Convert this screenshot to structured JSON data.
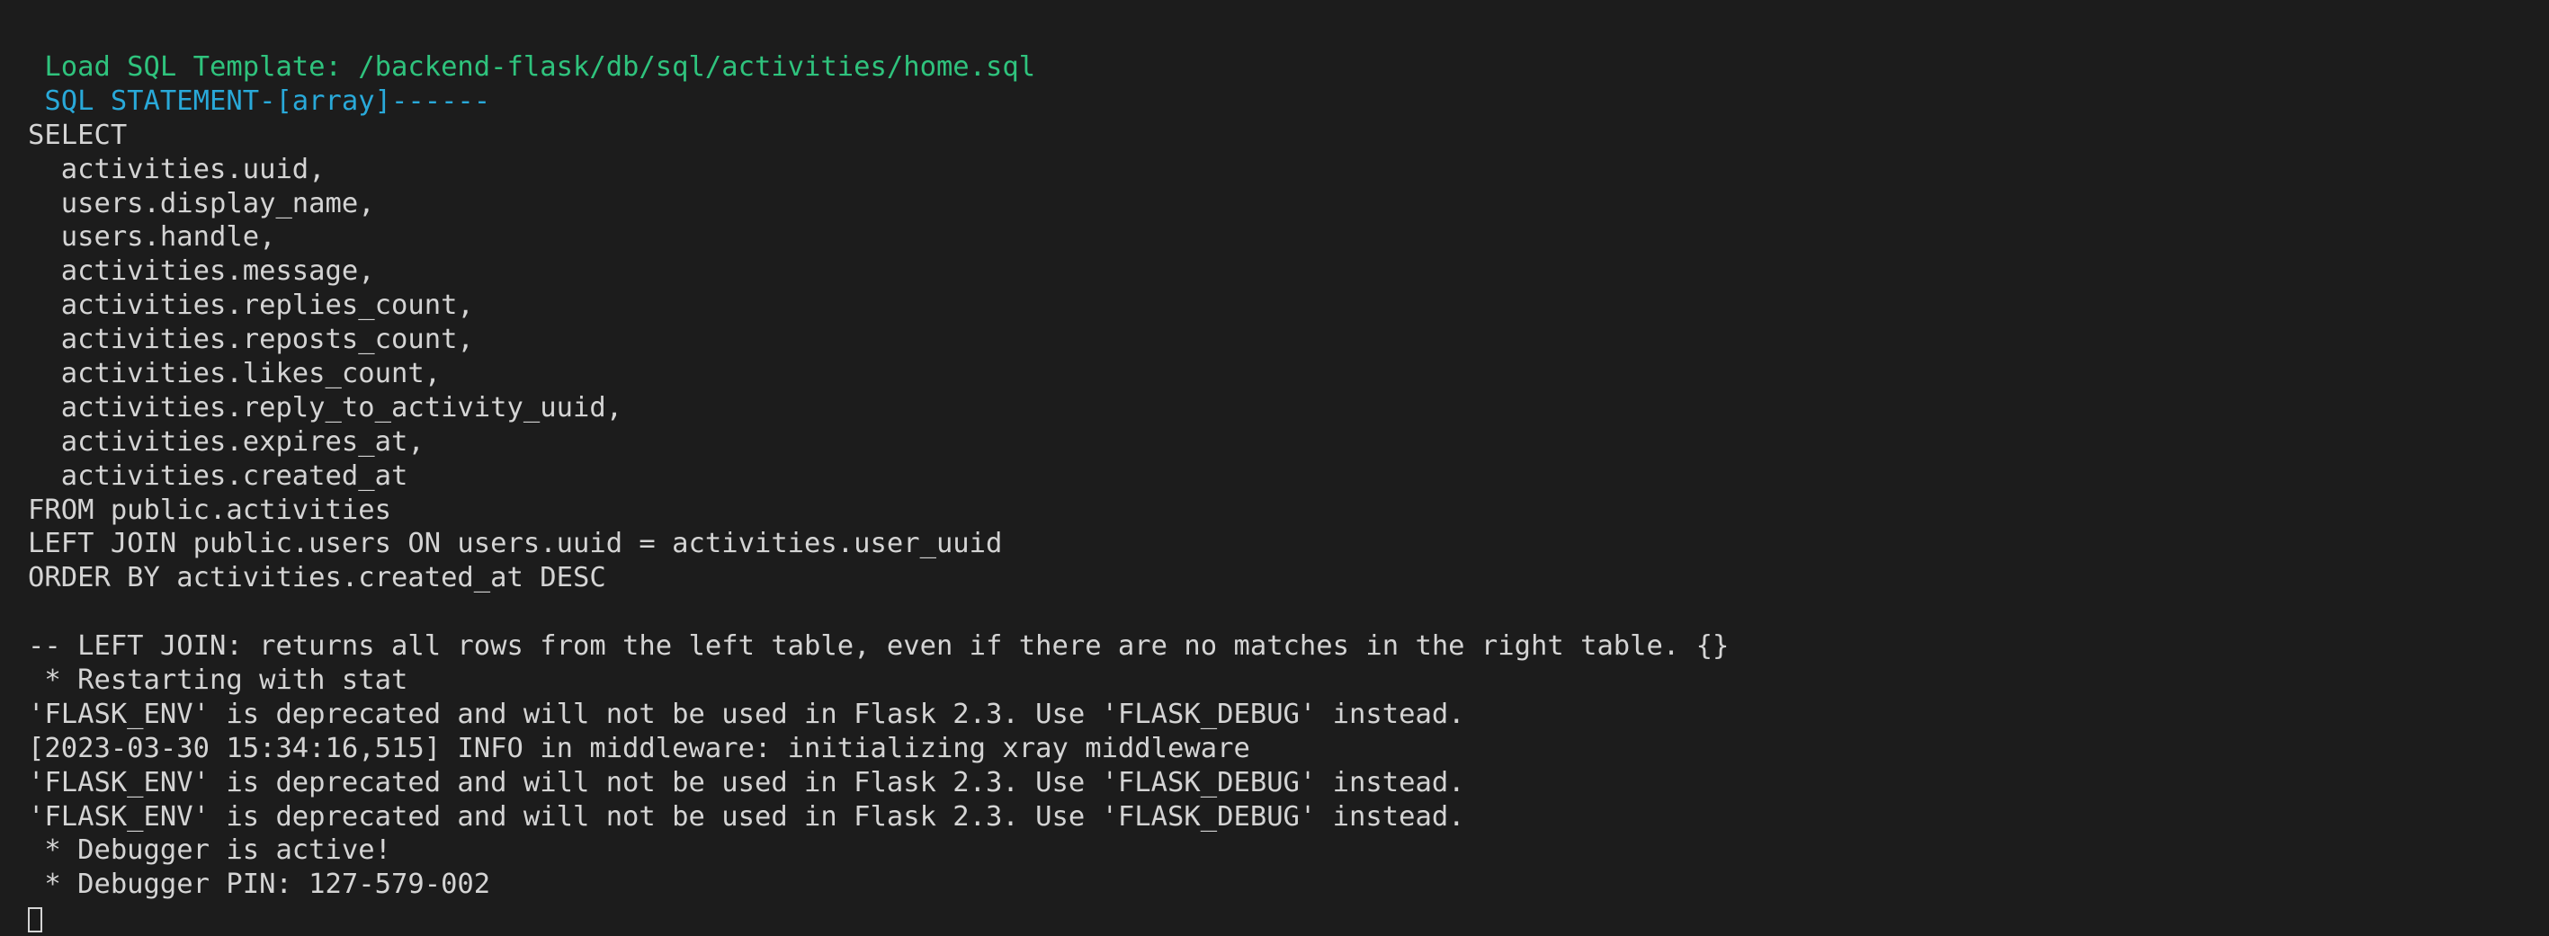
{
  "terminal": {
    "colors": {
      "background": "#1c1c1c",
      "text": "#d4d4d4",
      "template_line": "#2fc37d",
      "statement_line": "#29a9d9"
    },
    "lines": [
      " Load SQL Template: /backend-flask/db/sql/activities/home.sql",
      " SQL STATEMENT-[array]------",
      "SELECT",
      "  activities.uuid,",
      "  users.display_name,",
      "  users.handle,",
      "  activities.message,",
      "  activities.replies_count,",
      "  activities.reposts_count,",
      "  activities.likes_count,",
      "  activities.reply_to_activity_uuid,",
      "  activities.expires_at,",
      "  activities.created_at",
      "FROM public.activities",
      "LEFT JOIN public.users ON users.uuid = activities.user_uuid",
      "ORDER BY activities.created_at DESC",
      "",
      "-- LEFT JOIN: returns all rows from the left table, even if there are no matches in the right table. {}",
      " * Restarting with stat",
      "'FLASK_ENV' is deprecated and will not be used in Flask 2.3. Use 'FLASK_DEBUG' instead.",
      "[2023-03-30 15:34:16,515] INFO in middleware: initializing xray middleware",
      "'FLASK_ENV' is deprecated and will not be used in Flask 2.3. Use 'FLASK_DEBUG' instead.",
      "'FLASK_ENV' is deprecated and will not be used in Flask 2.3. Use 'FLASK_DEBUG' instead.",
      " * Debugger is active!",
      " * Debugger PIN: 127-579-002"
    ]
  }
}
